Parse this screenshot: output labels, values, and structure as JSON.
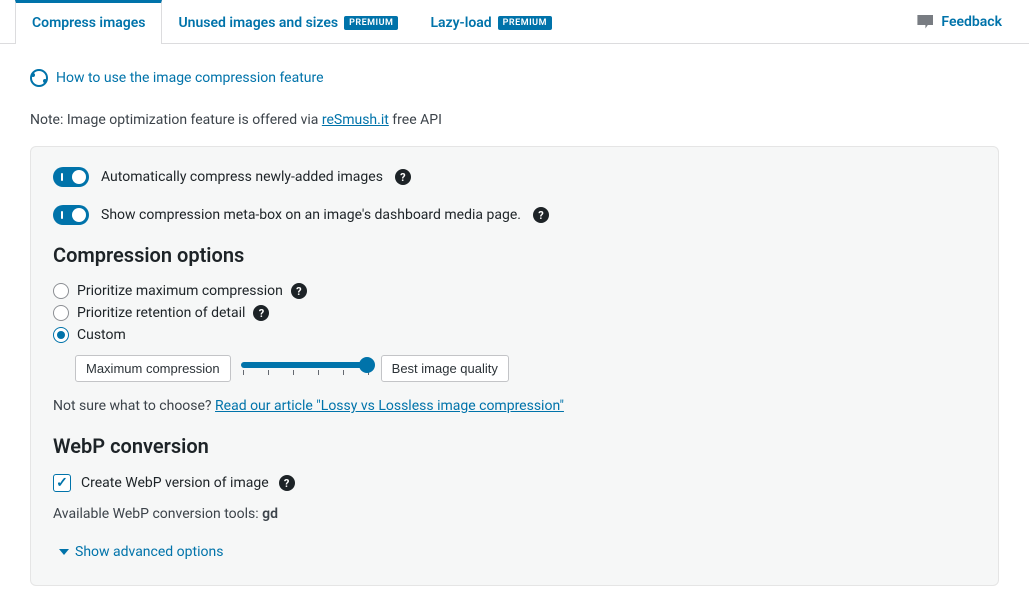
{
  "tabs": {
    "compress": "Compress images",
    "unused": "Unused images and sizes",
    "lazy": "Lazy-load",
    "premium_badge": "PREMIUM"
  },
  "feedback": {
    "label": "Feedback"
  },
  "help": {
    "link_text": "How to use the image compression feature"
  },
  "note": {
    "prefix": "Note: Image optimization feature is offered via ",
    "link": "reSmush.it",
    "suffix": " free API"
  },
  "toggles": {
    "auto_compress": "Automatically compress newly-added images",
    "metabox": "Show compression meta-box on an image's dashboard media page."
  },
  "sections": {
    "compression": "Compression options",
    "webp": "WebP conversion"
  },
  "radios": {
    "max_compress": "Prioritize maximum compression",
    "retention": "Prioritize retention of detail",
    "custom": "Custom"
  },
  "slider": {
    "min_label": "Maximum compression",
    "max_label": "Best image quality"
  },
  "hint": {
    "prefix": "Not sure what to choose? ",
    "link": "Read our article \"Lossy vs Lossless image compression\""
  },
  "webp": {
    "checkbox": "Create WebP version of image",
    "tools_prefix": "Available WebP conversion tools: ",
    "tools_value": "gd"
  },
  "advanced": {
    "label": "Show advanced options"
  }
}
